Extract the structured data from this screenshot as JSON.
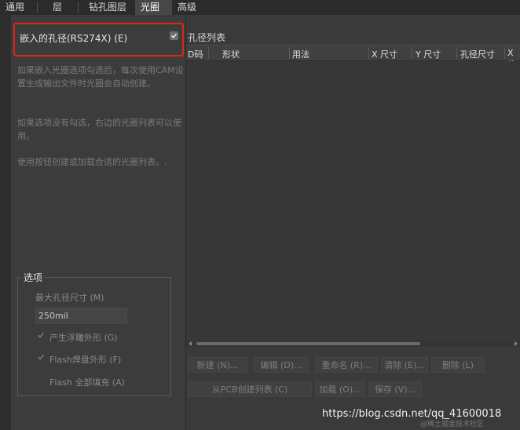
{
  "tabs": [
    {
      "label": "通用",
      "active": false
    },
    {
      "label": "层",
      "active": false
    },
    {
      "label": "钻孔图层",
      "active": false
    },
    {
      "label": "光圈",
      "active": true
    },
    {
      "label": "高级",
      "active": false
    }
  ],
  "left": {
    "embed_label": "嵌入的孔径(RS274X) (E)",
    "embed_checked": true,
    "desc1": "如果嵌入光圈选项勾选后，每次使用CAM设置生成输出文件时光圈会自动创建。",
    "desc2": "如果选项没有勾选，右边的光圈列表可以使用。",
    "desc3": "使用按钮创建或加载合适的光圈列表。.",
    "options": {
      "title": "选项",
      "max_size_label": "最大孔径尺寸 (M)",
      "max_size_value": "250mil",
      "relief_label": "产生浮雕外形 (G)",
      "flash_pad_label": "Flash焊盘外形 (F)",
      "flash_fill_label": "Flash 全部填充 (A)"
    }
  },
  "right": {
    "list_title": "孔径列表",
    "columns": [
      "D码",
      "形状",
      "用法",
      "X 尺寸",
      "Y 尺寸",
      "孔径尺寸",
      "X偏"
    ],
    "buttons_row1": [
      "新建 (N)...",
      "编辑 (D)...",
      "重命名 (R)...",
      "清除 (E)...",
      "删除 (L)"
    ],
    "buttons_row2": [
      "从PCB创建列表 (C)",
      "加载 (O)...",
      "保存 (V)..."
    ]
  },
  "watermark": "https://blog.csdn.net/qq_41600018",
  "watermark_small": "@稀土掘金技术社区",
  "colors": {
    "highlight_border": "#e2231a",
    "background": "#3a3a3a"
  }
}
